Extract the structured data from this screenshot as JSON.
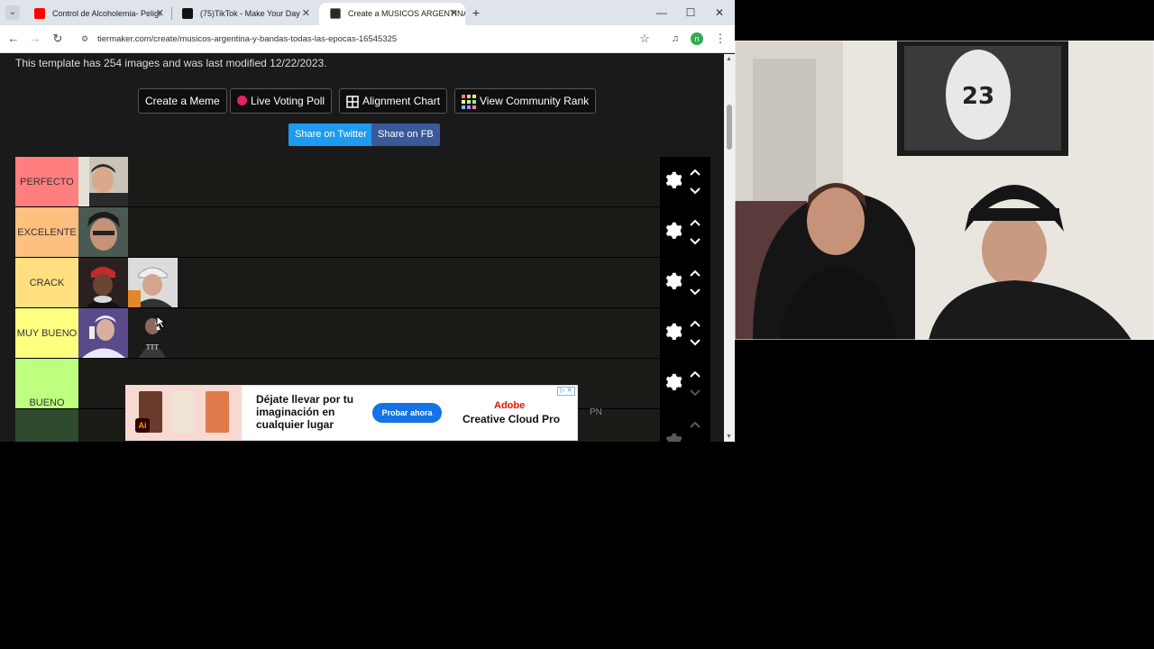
{
  "browser": {
    "tabs": [
      {
        "title": "Control de Alcoholemia- Peligr",
        "icon": "youtube-icon",
        "color": "#ff0000"
      },
      {
        "title": "(75)TikTok - Make Your Day",
        "icon": "tiktok-icon",
        "color": "#111111"
      },
      {
        "title": "Create a MUSICOS ARGENTINA",
        "icon": "tiermaker-icon",
        "color": "#2a2a2a"
      }
    ],
    "new_tab": "+",
    "url": "tiermaker.com/create/musicos-argentina-y-bandas-todas-las-epocas-16545325",
    "profile_initial": "n"
  },
  "page": {
    "template_info": "This template has 254 images and was last modified 12/22/2023.",
    "actions": {
      "create_meme": "Create a Meme",
      "live_poll": "Live Voting Poll",
      "alignment": "Alignment Chart",
      "community": "View Community Rank"
    },
    "share": {
      "twitter": "Share on Twitter",
      "fb": "Share on FB",
      "twitter_color": "#1d9bf0",
      "fb_color": "#3b5998"
    },
    "tiers": [
      {
        "label": "PERFECTO",
        "color": "#ff7f7f"
      },
      {
        "label": "EXCELENTE",
        "color": "#ffbf7f"
      },
      {
        "label": "CRACK",
        "color": "#ffdf7f"
      },
      {
        "label": "MUY BUENO",
        "color": "#ffff7f"
      },
      {
        "label": "BUENO",
        "color": "#bfff7f"
      },
      {
        "label": "",
        "color": "#7fff7f"
      }
    ]
  },
  "ad": {
    "headline": "Déjate llevar por tu imaginación en cualquier lugar",
    "cta": "Probar ahora",
    "brand": "Adobe",
    "product": "Creative Cloud Pro",
    "badge": "Ai",
    "tag": "PN"
  }
}
